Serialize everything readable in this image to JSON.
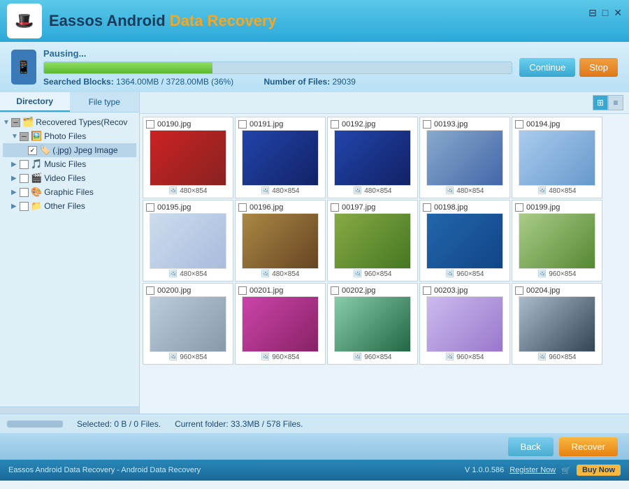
{
  "titlebar": {
    "logo": "🎩",
    "title_prefix": "Eassos Android ",
    "title_highlight": "Data Recovery",
    "controls": [
      "⊟",
      "□",
      "✕"
    ]
  },
  "progress": {
    "label": "Pausing...",
    "fill_percent": 36,
    "stats_blocks": "Searched Blocks:",
    "blocks_value": "1364.00MB / 3728.00MB (36%)",
    "stats_files": "Number of Files:",
    "files_value": "29039",
    "btn_continue": "Continue",
    "btn_stop": "Stop"
  },
  "sidebar": {
    "tab_directory": "Directory",
    "tab_filetype": "File type",
    "tree": [
      {
        "level": 0,
        "toggle": "▼",
        "check": "partial",
        "icon": "🗂️",
        "label": "Recovered Types(Recov"
      },
      {
        "level": 1,
        "toggle": "▼",
        "check": "partial",
        "icon": "🖼️",
        "label": "Photo Files"
      },
      {
        "level": 2,
        "toggle": " ",
        "check": "checked",
        "icon": "🏷️",
        "label": "(.jpg) Jpeg Image"
      },
      {
        "level": 1,
        "toggle": "▶",
        "check": "unchecked",
        "icon": "🎵",
        "label": "Music Files"
      },
      {
        "level": 1,
        "toggle": "▶",
        "check": "unchecked",
        "icon": "🎬",
        "label": "Video Files"
      },
      {
        "level": 1,
        "toggle": "▶",
        "check": "unchecked",
        "icon": "🎨",
        "label": "Graphic Files"
      },
      {
        "level": 1,
        "toggle": "▶",
        "check": "unchecked",
        "icon": "📁",
        "label": "Other Files"
      }
    ]
  },
  "grid": {
    "view_grid_label": "⊞",
    "view_list_label": "≡",
    "rows": [
      {
        "items": [
          {
            "name": "00190.jpg",
            "dims": "480×854",
            "color": "img-red"
          },
          {
            "name": "00191.jpg",
            "dims": "480×854",
            "color": "img-blue"
          },
          {
            "name": "00192.jpg",
            "dims": "480×854",
            "color": "img-blue"
          },
          {
            "name": "00193.jpg",
            "dims": "480×854",
            "color": "img-girl"
          },
          {
            "name": "00194.jpg",
            "dims": "480×854",
            "color": "img-winter"
          }
        ]
      },
      {
        "items": [
          {
            "name": "00195.jpg",
            "dims": "480×854",
            "color": "img-snow"
          },
          {
            "name": "00196.jpg",
            "dims": "480×854",
            "color": "img-dog"
          },
          {
            "name": "00197.jpg",
            "dims": "960×854",
            "color": "img-deer"
          },
          {
            "name": "00198.jpg",
            "dims": "960×854",
            "color": "img-surf"
          },
          {
            "name": "00199.jpg",
            "dims": "960×854",
            "color": "img-beach"
          }
        ]
      },
      {
        "items": [
          {
            "name": "00200.jpg",
            "dims": "960×854",
            "color": "img-snow2"
          },
          {
            "name": "00201.jpg",
            "dims": "960×854",
            "color": "img-flower"
          },
          {
            "name": "00202.jpg",
            "dims": "960×854",
            "color": "img-plant"
          },
          {
            "name": "00203.jpg",
            "dims": "960×854",
            "color": "img-blossom"
          },
          {
            "name": "00204.jpg",
            "dims": "960×854",
            "color": "img-factory"
          }
        ]
      }
    ]
  },
  "statusbar": {
    "selected": "Selected: 0 B / 0 Files.",
    "current_folder": "Current folder: 33.3MB / 578 Files."
  },
  "bottom": {
    "btn_back": "Back",
    "btn_recover": "Recover"
  },
  "footer": {
    "left": "Eassos Android Data Recovery - Android Data Recovery",
    "version": "V 1.0.0.586",
    "register": "Register Now",
    "buy": "Buy Now"
  }
}
